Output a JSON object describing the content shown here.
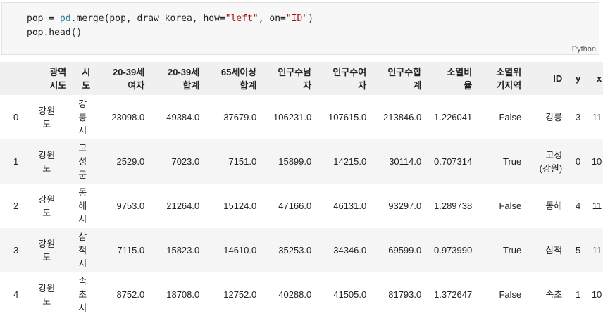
{
  "code_cell": {
    "line1": {
      "var": "pop",
      "eq": " = ",
      "module": "pd",
      "rest1": ".merge(pop, draw_korea, how=",
      "str1": "\"left\"",
      "rest2": ", on=",
      "str2": "\"ID\"",
      "rest3": ")"
    },
    "line2": "pop.head()",
    "language": "Python"
  },
  "table": {
    "columns": [
      {
        "key": "index",
        "label": ""
      },
      {
        "key": "gwangyeok",
        "label": "광역\n시도"
      },
      {
        "key": "sido",
        "label": "시\n도"
      },
      {
        "key": "f2039",
        "label": "20-39세\n여자"
      },
      {
        "key": "t2039",
        "label": "20-39세\n합계"
      },
      {
        "key": "t65",
        "label": "65세이상\n합계"
      },
      {
        "key": "male",
        "label": "인구수남\n자"
      },
      {
        "key": "female",
        "label": "인구수여\n자"
      },
      {
        "key": "total",
        "label": "인구수합\n계"
      },
      {
        "key": "ratio",
        "label": "소멸비\n율"
      },
      {
        "key": "risk",
        "label": "소멸위\n기지역"
      },
      {
        "key": "id",
        "label": "ID"
      },
      {
        "key": "y",
        "label": "y"
      },
      {
        "key": "x",
        "label": "x"
      }
    ],
    "rows": [
      {
        "index": "0",
        "gwangyeok": "강원\n도",
        "sido": "강\n릉\n시",
        "f2039": "23098.0",
        "t2039": "49384.0",
        "t65": "37679.0",
        "male": "106231.0",
        "female": "107615.0",
        "total": "213846.0",
        "ratio": "1.226041",
        "risk": "False",
        "id": "강릉",
        "y": "3",
        "x": "11"
      },
      {
        "index": "1",
        "gwangyeok": "강원\n도",
        "sido": "고\n성\n군",
        "f2039": "2529.0",
        "t2039": "7023.0",
        "t65": "7151.0",
        "male": "15899.0",
        "female": "14215.0",
        "total": "30114.0",
        "ratio": "0.707314",
        "risk": "True",
        "id": "고성\n(강원)",
        "y": "0",
        "x": "10"
      },
      {
        "index": "2",
        "gwangyeok": "강원\n도",
        "sido": "동\n해\n시",
        "f2039": "9753.0",
        "t2039": "21264.0",
        "t65": "15124.0",
        "male": "47166.0",
        "female": "46131.0",
        "total": "93297.0",
        "ratio": "1.289738",
        "risk": "False",
        "id": "동해",
        "y": "4",
        "x": "11"
      },
      {
        "index": "3",
        "gwangyeok": "강원\n도",
        "sido": "삼\n척\n시",
        "f2039": "7115.0",
        "t2039": "15823.0",
        "t65": "14610.0",
        "male": "35253.0",
        "female": "34346.0",
        "total": "69599.0",
        "ratio": "0.973990",
        "risk": "True",
        "id": "삼척",
        "y": "5",
        "x": "11"
      },
      {
        "index": "4",
        "gwangyeok": "강원\n도",
        "sido": "속\n초\n시",
        "f2039": "8752.0",
        "t2039": "18708.0",
        "t65": "12752.0",
        "male": "40288.0",
        "female": "41505.0",
        "total": "81793.0",
        "ratio": "1.372647",
        "risk": "False",
        "id": "속초",
        "y": "1",
        "x": "10"
      }
    ]
  }
}
